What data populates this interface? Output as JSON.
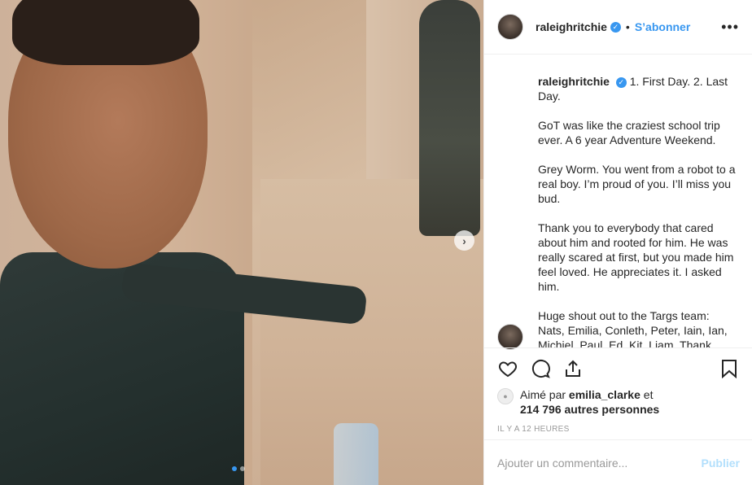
{
  "post": {
    "username": "raleighritchie",
    "verified": true,
    "separator": "•",
    "follow_label": "S’abonner",
    "more_label": "•••",
    "carousel": {
      "current_index": 1,
      "total": 2,
      "next_icon": "chevron-right-icon"
    }
  },
  "caption": {
    "username": "raleighritchie",
    "paragraphs": [
      "1. First Day. 2. Last Day.",
      "GoT was like the craziest school trip ever. A 6 year Adventure Weekend.",
      "Grey Worm. You went from a robot to a real boy. I’m proud of you. I’ll miss you bud.",
      "Thank you to everybody that cared about him and rooted for him. He was really scared at first, but you made him feel loved. He appreciates it. I asked him.",
      "Huge shout out to the Targs team: Nats, Emilia, Conleth, Peter, Iain, Ian, Michiel, Paul, Ed, Kit, Liam. Thank"
    ]
  },
  "actions": {
    "like_icon": "heart-icon",
    "comment_icon": "comment-icon",
    "share_icon": "share-icon",
    "save_icon": "bookmark-icon"
  },
  "likes": {
    "prefix": "Aimé par",
    "liker": "emilia_clarke",
    "connector": "et",
    "count_text": "214 796 autres personnes"
  },
  "timestamp": "IL Y A 12 HEURES",
  "comment_box": {
    "placeholder": "Ajouter un commentaire...",
    "publish_label": "Publier"
  },
  "colors": {
    "accent": "#3897f0",
    "publish_disabled": "#b2dffc",
    "muted": "#999999",
    "text": "#262626",
    "border": "#efefef"
  }
}
